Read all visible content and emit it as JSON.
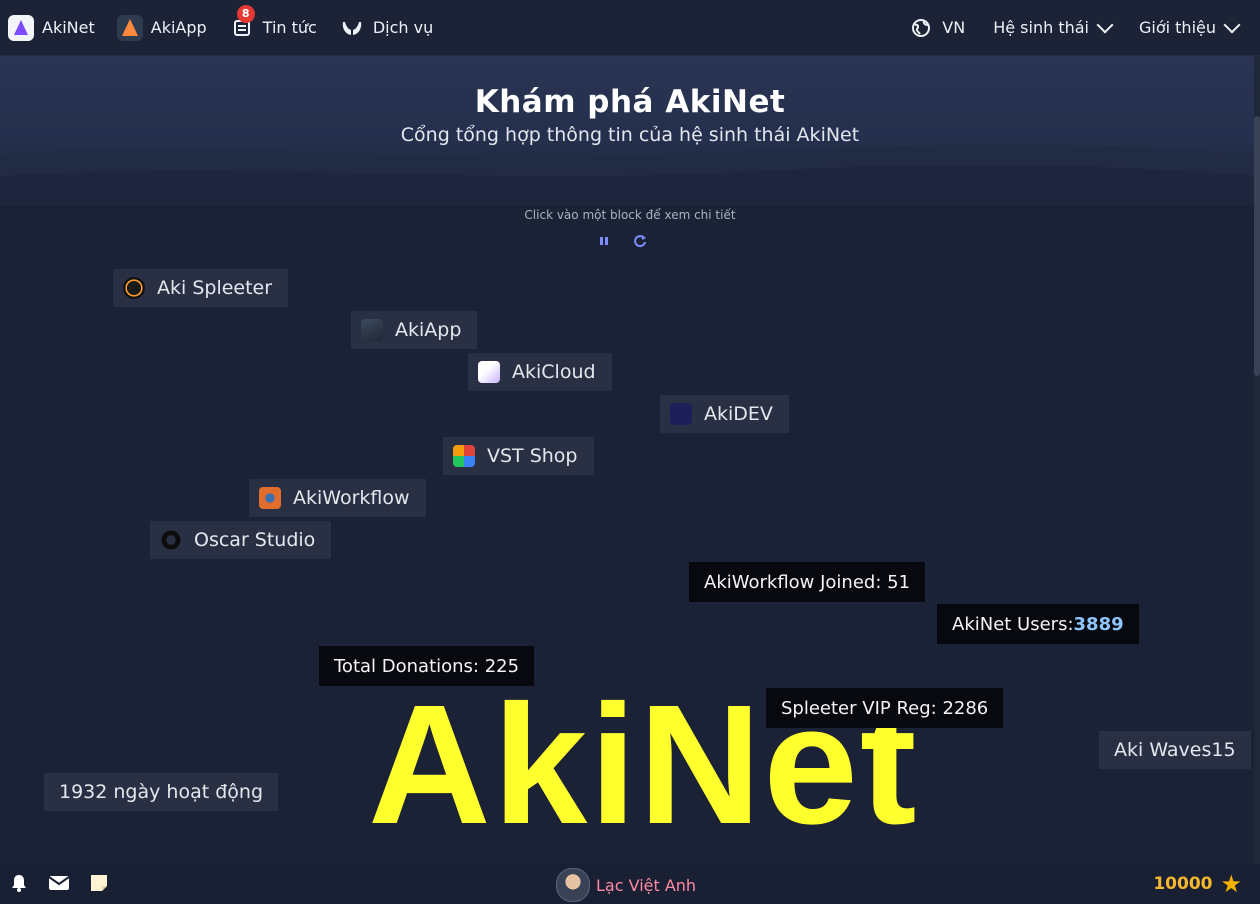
{
  "nav": {
    "left": [
      {
        "label": "AkiNet",
        "icon": "akinet-logo-icon"
      },
      {
        "label": "AkiApp",
        "icon": "akiapp-logo-icon"
      },
      {
        "label": "Tin tức",
        "icon": "news-icon",
        "badge": "8"
      },
      {
        "label": "Dịch vụ",
        "icon": "hands-icon"
      }
    ],
    "right": {
      "language": "VN",
      "ecosystem": "Hệ sinh thái",
      "about": "Giới thiệu"
    }
  },
  "hero": {
    "title": "Khám phá AkiNet",
    "subtitle": "Cổng tổng hợp thông tin của hệ sinh thái AkiNet"
  },
  "hint": "Click vào một block để xem chi tiết",
  "blocks": [
    {
      "label": "Aki Spleeter",
      "icon": "spleeter-icon"
    },
    {
      "label": "AkiApp",
      "icon": "akiapp-icon"
    },
    {
      "label": "AkiCloud",
      "icon": "akicloud-icon"
    },
    {
      "label": "AkiDEV",
      "icon": "akidev-icon"
    },
    {
      "label": "VST Shop",
      "icon": "vst-shop-icon"
    },
    {
      "label": "AkiWorkflow",
      "icon": "akiworkflow-icon"
    },
    {
      "label": "Oscar Studio",
      "icon": "oscar-studio-icon"
    },
    {
      "label": "Aki Waves15"
    },
    {
      "label": "1932 ngày hoạt động"
    }
  ],
  "stats": {
    "workflow": "AkiWorkflow Joined: 51",
    "users_label": "AkiNet Users:",
    "users_value": "3889",
    "donations": "Total Donations: 225",
    "spleeter": "Spleeter VIP Reg: 2286"
  },
  "big_word": "AkiNet",
  "footer": {
    "user": "Lạc Việt Anh",
    "coins": "10000"
  },
  "colors": {
    "background": "#1b2235",
    "block": "#2a3043",
    "stat": "#07090f",
    "accent_yellow": "#ffff2e",
    "user_pink": "#ff8aa3",
    "coin_gold": "#f3b82d"
  }
}
